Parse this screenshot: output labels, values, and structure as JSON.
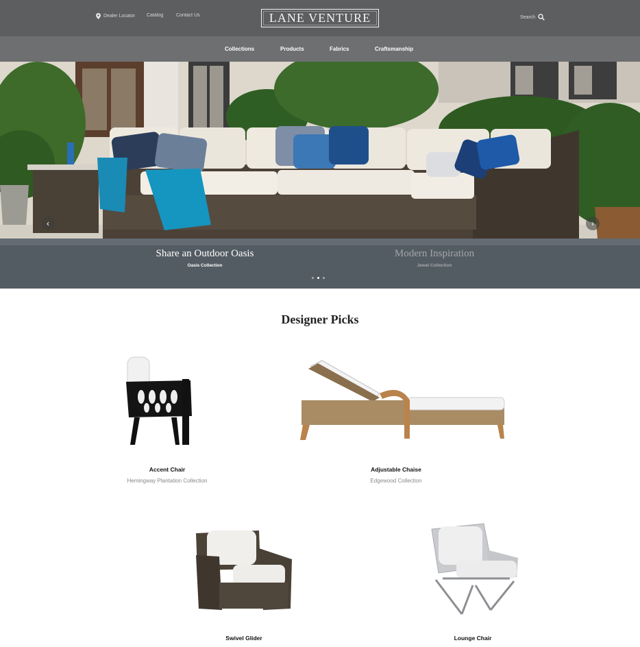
{
  "header": {
    "dealer_locator": "Dealer Locator",
    "catalog": "Catalog",
    "contact": "Contact Us",
    "logo": "LANE VENTURE",
    "search": "Search"
  },
  "nav": {
    "collections": "Collections",
    "products": "Products",
    "fabrics": "Fabrics",
    "craftsmanship": "Craftsmanship"
  },
  "hero": {
    "slides": [
      {
        "title": "Share an Outdoor Oasis",
        "subtitle": "Oasis Collection"
      },
      {
        "title": "Modern Inspiration",
        "subtitle": "Jewel Collection"
      }
    ],
    "dots": 3,
    "active_dot": 1
  },
  "picks": {
    "title": "Designer Picks",
    "items": [
      {
        "name": "Accent Chair",
        "collection": "Hemingway Plantation Collection"
      },
      {
        "name": "Adjustable Chaise",
        "collection": "Edgewood Collection"
      },
      {
        "name": "Swivel Glider",
        "collection": ""
      },
      {
        "name": "Lounge Chair",
        "collection": ""
      }
    ]
  },
  "colors": {
    "topbar": "#5d5e60",
    "navbar": "#6e6f71",
    "wicker_dark": "#4a4136",
    "cushion": "#eee9df",
    "accent_blue": "#1e63a8",
    "teal_throw": "#1a8bb5"
  },
  "icons": {
    "location": "map-pin-icon",
    "search": "magnifier-icon",
    "prev": "chevron-left-icon",
    "next": "chevron-right-icon"
  }
}
